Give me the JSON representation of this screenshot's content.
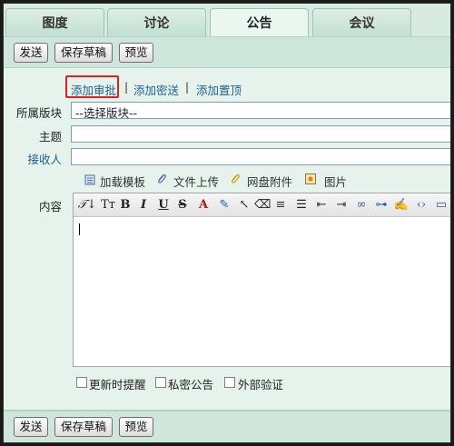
{
  "tabs": [
    {
      "label": "图度"
    },
    {
      "label": "讨论"
    },
    {
      "label": "公告",
      "active": true
    },
    {
      "label": "会议"
    }
  ],
  "toolbar": {
    "send": "发送",
    "save_draft": "保存草稿",
    "preview": "预览"
  },
  "links": {
    "add_approval": "添加审批",
    "add_secret": "添加密送",
    "add_pin": "添加置顶",
    "separator": "|"
  },
  "form": {
    "board_label": "所属版块",
    "board_value": "--选择版块--",
    "subject_label": "主题",
    "subject_value": "",
    "recipient_label": "接收人",
    "recipient_value": "",
    "content_label": "内容"
  },
  "attachments": {
    "template": "加载模板",
    "upload": "文件上传",
    "netdisk": "网盘附件",
    "image": "图片"
  },
  "options": {
    "remind": "更新时提醒",
    "private": "私密公告",
    "external": "外部验证"
  },
  "colors": {
    "link": "#1d5f8f",
    "highlight": "#e21f1f",
    "background": "#d8ebe3"
  }
}
